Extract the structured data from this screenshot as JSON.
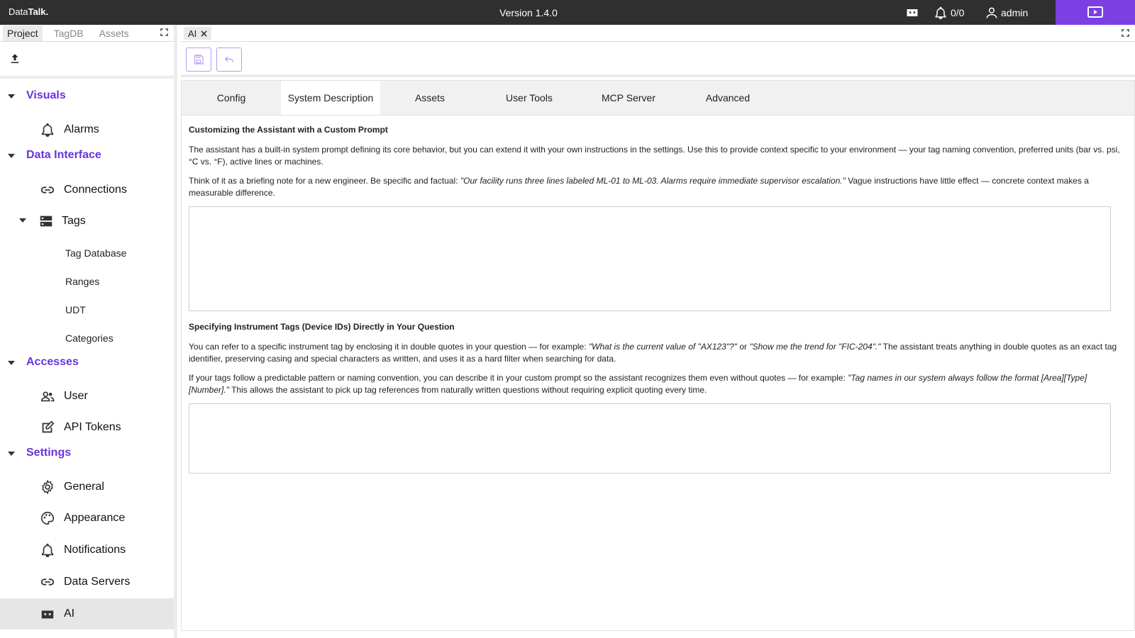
{
  "app": {
    "logo_prefix": "Data",
    "logo_bold": "Talk.",
    "version": "Version 1.4.0",
    "alarm_count": "0/0",
    "user": "admin"
  },
  "sidebar": {
    "tabs": [
      "Project",
      "TagDB",
      "Assets"
    ],
    "sections": {
      "visuals": "Visuals",
      "data_interface": "Data Interface",
      "accesses": "Accesses",
      "settings": "Settings"
    },
    "items": {
      "alarms": "Alarms",
      "connections": "Connections",
      "tags": "Tags",
      "tag_database": "Tag Database",
      "ranges": "Ranges",
      "udt": "UDT",
      "categories": "Categories",
      "user": "User",
      "api_tokens": "API Tokens",
      "general": "General",
      "appearance": "Appearance",
      "notifications": "Notifications",
      "data_servers": "Data Servers",
      "ai": "AI"
    }
  },
  "editor": {
    "doc_tab": "AI",
    "tabs": [
      "Config",
      "System Description",
      "Assets",
      "User Tools",
      "MCP Server",
      "Advanced"
    ]
  },
  "content": {
    "section1_title": "Customizing the Assistant with a Custom Prompt",
    "section1_p1": "The assistant has a built-in system prompt defining its core behavior, but you can extend it with your own instructions in the settings. Use this to provide context specific to your environment — your tag naming convention, preferred units (bar vs. psi, °C vs. °F), active lines or machines.",
    "section1_p2_a": "Think of it as a briefing note for a new engineer. Be specific and factual: ",
    "section1_p2_quote": "\"Our facility runs three lines labeled ML-01 to ML-03. Alarms require immediate supervisor escalation.\"",
    "section1_p2_b": " Vague instructions have little effect — concrete context makes a measurable difference.",
    "custom_prompt_value": "",
    "section2_title": "Specifying Instrument Tags (Device IDs) Directly in Your Question",
    "section2_p1_a": "You can refer to a specific instrument tag by enclosing it in double quotes in your question — for example: ",
    "section2_p1_q1": "\"What is the current value of \"AX123\"?\"",
    "section2_p1_or": " or ",
    "section2_p1_q2": "\"Show me the trend for \"FIC-204\".\"",
    "section2_p1_b": " The assistant treats anything in double quotes as an exact tag identifier, preserving casing and special characters as written, and uses it as a hard filter when searching for data.",
    "section2_p2_a": "If your tags follow a predictable pattern or naming convention, you can describe it in your custom prompt so the assistant recognizes them even without quotes — for example: ",
    "section2_p2_quote": "\"Tag names in our system always follow the format [Area][Type][Number].\"",
    "section2_p2_b": " This allows the assistant to pick up tag references from naturally written questions without requiring explicit quoting every time.",
    "tag_pattern_value": ""
  },
  "colors": {
    "accent": "#6b33e0",
    "topbar": "#2f2f2f",
    "present_button": "#7b3fe4"
  }
}
